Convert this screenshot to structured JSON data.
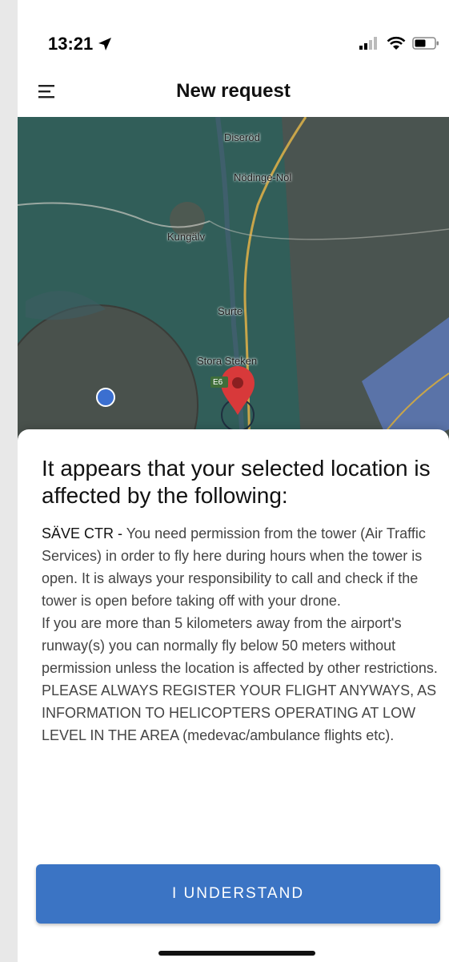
{
  "status_bar": {
    "time": "13:21",
    "icons": [
      "location-arrow-icon",
      "cellular-signal-icon",
      "wifi-icon",
      "battery-icon"
    ]
  },
  "header": {
    "title": "New request",
    "menu_icon": "hamburger-menu-icon"
  },
  "map": {
    "labels": {
      "diserod": "Diseröd",
      "nodinge": "Nödinge-Nol",
      "kungalv": "Kungälv",
      "surte": "Surte",
      "stora_steken": "Stora Steken",
      "road_sign": "E6"
    },
    "colors": {
      "land": "#4a5450",
      "restricted_zone": "#2f5f5a",
      "water": "#5a73a8",
      "road": "#c8a54a",
      "marker": "#d8393a"
    }
  },
  "sheet": {
    "heading": "It appears that your selected location is affected by the following:",
    "zone_name": "SÄVE CTR -",
    "paragraph_1": " You need permission from the tower (Air Traffic Services) in order to fly here during hours when the tower is open. It is always your responsibility to call and check if the tower is open before taking off with your drone.",
    "paragraph_2": "If you are more than 5 kilometers away from the airport's runway(s) you can normally fly below 50 meters without permission unless the location is affected by other restrictions. PLEASE ALWAYS REGISTER YOUR FLIGHT ANYWAYS, AS INFORMATION TO HELICOPTERS OPERATING AT LOW LEVEL IN THE AREA (medevac/ambulance flights etc).",
    "button_label": "I UNDERSTAND"
  },
  "colors": {
    "accent": "#3b74c4"
  }
}
